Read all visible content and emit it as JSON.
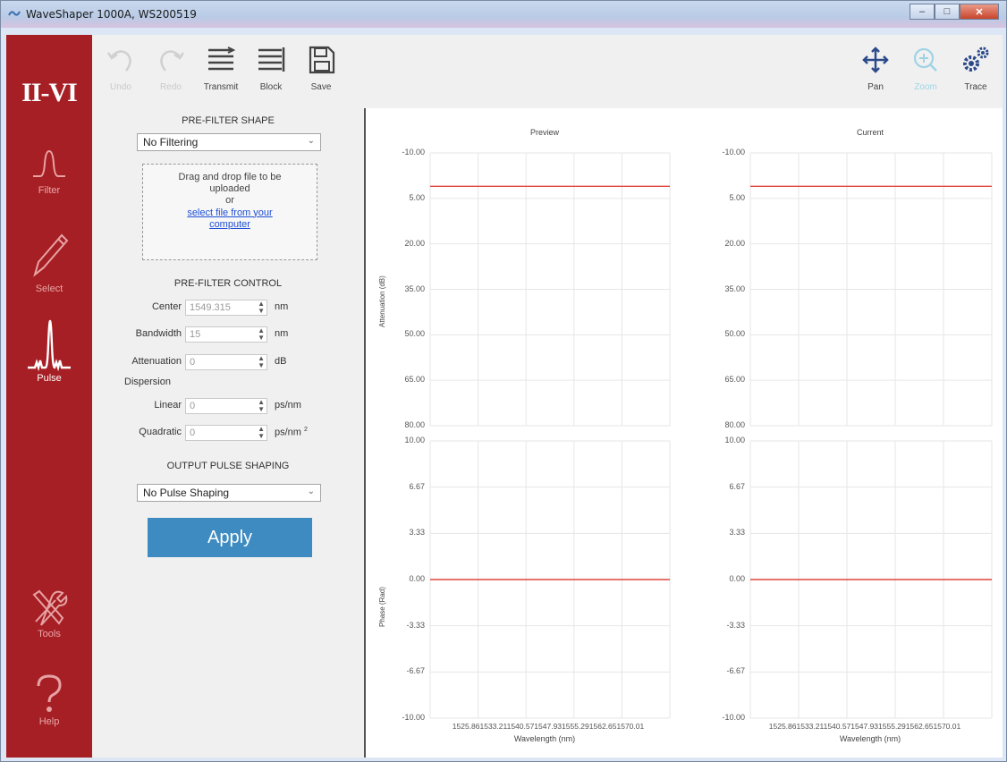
{
  "window": {
    "title": "WaveShaper 1000A, WS200519"
  },
  "sidebar": {
    "logo": "II-VI",
    "items": [
      {
        "label": "Filter",
        "icon": "filter-shape-icon",
        "active": false
      },
      {
        "label": "Select",
        "icon": "pencil-icon",
        "active": false
      },
      {
        "label": "Pulse",
        "icon": "pulse-icon",
        "active": true
      },
      {
        "label": "Tools",
        "icon": "tools-icon",
        "active": false
      },
      {
        "label": "Help",
        "icon": "help-icon",
        "active": false
      }
    ]
  },
  "toolbar": {
    "undo_label": "Undo",
    "redo_label": "Redo",
    "transmit_label": "Transmit",
    "block_label": "Block",
    "save_label": "Save",
    "pan_label": "Pan",
    "zoom_label": "Zoom",
    "trace_label": "Trace"
  },
  "prefilter_shape": {
    "title": "PRE-FILTER SHAPE",
    "selected": "No Filtering",
    "drop_text_1": "Drag and drop file to be",
    "drop_text_2": "uploaded",
    "drop_or": "or",
    "drop_link_1": "select file from your",
    "drop_link_2": "computer"
  },
  "prefilter_control": {
    "title": "PRE-FILTER CONTROL",
    "center_label": "Center",
    "center_value": "1549.315",
    "center_unit": "nm",
    "bandwidth_label": "Bandwidth",
    "bandwidth_value": "15",
    "bandwidth_unit": "nm",
    "attenuation_label": "Attenuation",
    "attenuation_value": "0",
    "attenuation_unit": "dB",
    "dispersion_label": "Dispersion",
    "linear_label": "Linear",
    "linear_value": "0",
    "linear_unit": "ps/nm",
    "quadratic_label": "Quadratic",
    "quadratic_value": "0",
    "quadratic_unit": "ps/nm",
    "quadratic_sup": "2"
  },
  "output_pulse": {
    "title": "OUTPUT PULSE SHAPING",
    "selected": "No Pulse Shaping",
    "apply_label": "Apply"
  },
  "plots": {
    "preview_title": "Preview",
    "current_title": "Current",
    "atten_ylabel": "Attenuation (dB)",
    "phase_ylabel": "Phase (Rad)",
    "xlabel": "Wavelength (nm)",
    "atten_ticks": [
      "-10.00",
      "5.00",
      "20.00",
      "35.00",
      "50.00",
      "65.00",
      "80.00"
    ],
    "phase_ticks": [
      "10.00",
      "6.67",
      "3.33",
      "0.00",
      "-3.33",
      "-6.67",
      "-10.00"
    ],
    "x_ticks_text": "1525.861533.211540.571547.931555.291562.651570.01"
  },
  "chart_data": [
    {
      "type": "line",
      "title": "Preview",
      "ylabel": "Attenuation (dB)",
      "xlabel": "",
      "ylim": [
        -10,
        80
      ],
      "xlim": [
        1525.86,
        1570.01
      ],
      "series": [
        {
          "x": [
            1525.86,
            1570.01
          ],
          "y": [
            1.0,
            1.0
          ]
        }
      ]
    },
    {
      "type": "line",
      "title": "",
      "ylabel": "Phase (Rad)",
      "xlabel": "Wavelength (nm)",
      "ylim": [
        -10,
        10
      ],
      "xlim": [
        1525.86,
        1570.01
      ],
      "series": [
        {
          "x": [
            1525.86,
            1570.01
          ],
          "y": [
            0,
            0
          ]
        }
      ]
    },
    {
      "type": "line",
      "title": "Current",
      "ylabel": "",
      "xlabel": "",
      "ylim": [
        -10,
        80
      ],
      "xlim": [
        1525.86,
        1570.01
      ],
      "series": [
        {
          "x": [
            1525.86,
            1570.01
          ],
          "y": [
            1.0,
            1.0
          ]
        }
      ]
    },
    {
      "type": "line",
      "title": "",
      "ylabel": "",
      "xlabel": "Wavelength (nm)",
      "ylim": [
        -10,
        10
      ],
      "xlim": [
        1525.86,
        1570.01
      ],
      "series": [
        {
          "x": [
            1525.86,
            1570.01
          ],
          "y": [
            0,
            0
          ]
        }
      ]
    }
  ],
  "colors": {
    "sidebar": "#a61f24",
    "trace": "#e0453a",
    "apply": "#3d8bc0"
  }
}
